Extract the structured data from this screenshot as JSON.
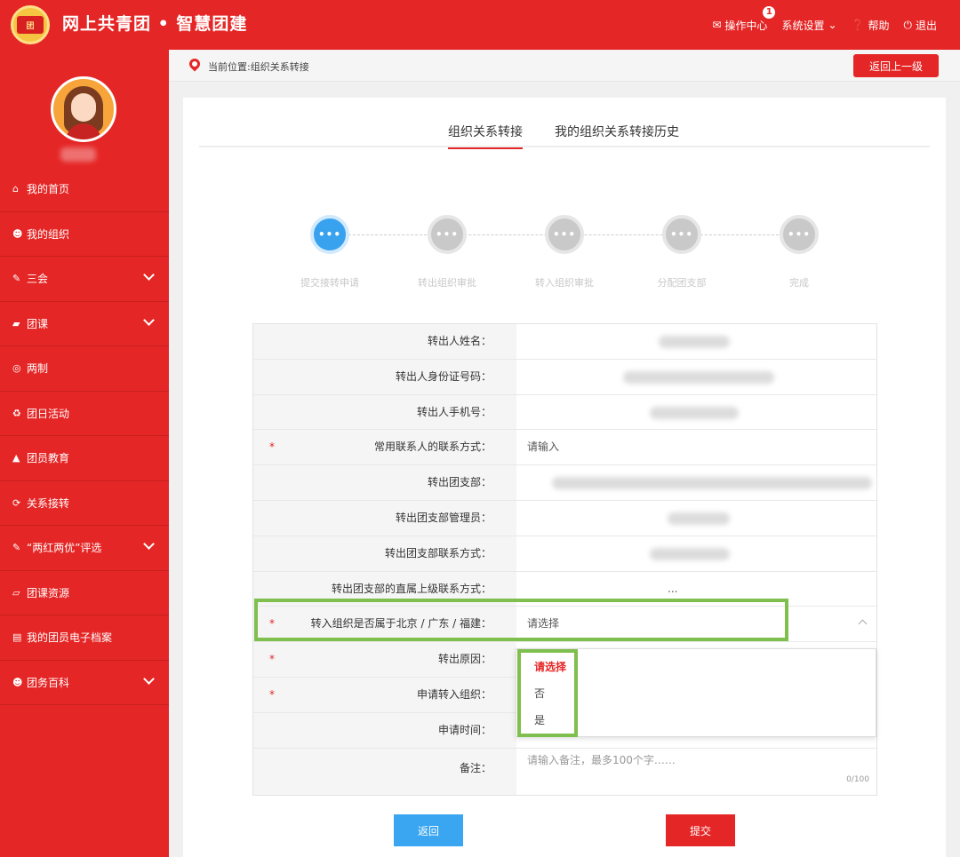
{
  "header": {
    "logo_text": "团",
    "title": "网上共青团 • 智慧团建",
    "nav": [
      {
        "icon": "envelope-icon",
        "label": "操作中心",
        "badge": "1"
      },
      {
        "icon": "chevron-down-icon",
        "label": "系统设置"
      },
      {
        "icon": "question-icon",
        "label": "帮助"
      },
      {
        "icon": "power-icon",
        "label": "退出"
      }
    ]
  },
  "sidebar": {
    "items": [
      {
        "icon": "home-icon",
        "label": "我的首页",
        "has_submenu": false
      },
      {
        "icon": "users-icon",
        "label": "我的组织",
        "has_submenu": false
      },
      {
        "icon": "edit-icon",
        "label": "三会",
        "has_submenu": true
      },
      {
        "icon": "folder-icon",
        "label": "团课",
        "has_submenu": true
      },
      {
        "icon": "target-icon",
        "label": "两制",
        "has_submenu": false
      },
      {
        "icon": "recycle-icon",
        "label": "团日活动",
        "has_submenu": false
      },
      {
        "icon": "graduation-cap-icon",
        "label": "团员教育",
        "has_submenu": false
      },
      {
        "icon": "refresh-icon",
        "label": "关系接转",
        "has_submenu": false
      },
      {
        "icon": "edit-icon",
        "label": "“两红两优”评选",
        "has_submenu": true
      },
      {
        "icon": "folder-open-icon",
        "label": "团课资源",
        "has_submenu": false
      },
      {
        "icon": "file-icon",
        "label": "我的团员电子档案",
        "has_submenu": false
      },
      {
        "icon": "users-icon",
        "label": "团务百科",
        "has_submenu": true
      }
    ]
  },
  "breadcrumb": {
    "text": "当前位置:组织关系转接",
    "back_button": "返回上一级"
  },
  "tabs": [
    {
      "label": "组织关系转接",
      "active": true
    },
    {
      "label": "我的组织关系转接历史",
      "active": false
    }
  ],
  "steps": [
    {
      "dots": "•••",
      "label": "提交接转申请",
      "active": true
    },
    {
      "dots": "•••",
      "label": "转出组织审批",
      "active": false
    },
    {
      "dots": "•••",
      "label": "转入组织审批",
      "active": false
    },
    {
      "dots": "•••",
      "label": "分配团支部",
      "active": false
    },
    {
      "dots": "•••",
      "label": "完成",
      "active": false
    }
  ],
  "form": {
    "rows": [
      {
        "label": "转出人姓名：",
        "required": false,
        "value": ""
      },
      {
        "label": "转出人身份证号码：",
        "required": false,
        "value": ""
      },
      {
        "label": "转出人手机号：",
        "required": false,
        "value": ""
      },
      {
        "label": "常用联系人的联系方式：",
        "required": true,
        "value": "请输入"
      },
      {
        "label": "转出团支部：",
        "required": false,
        "value": ""
      },
      {
        "label": "转出团支部管理员：",
        "required": false,
        "value": ""
      },
      {
        "label": "转出团支部联系方式：",
        "required": false,
        "value": ""
      },
      {
        "label": "转出团支部的直属上级联系方式：",
        "required": false,
        "value": "..."
      },
      {
        "label": "转入组织是否属于北京 / 广东 / 福建：",
        "required": true,
        "value": "请选择"
      },
      {
        "label": "转出原因：",
        "required": true,
        "value": ""
      },
      {
        "label": "申请转入组织：",
        "required": true,
        "value": ""
      },
      {
        "label": "申请时间：",
        "required": false,
        "value": ""
      }
    ],
    "remark": {
      "label": "备注：",
      "placeholder": "请输入备注，最多100个字……",
      "counter": "0/100"
    },
    "required_mark": "*"
  },
  "dropdown": {
    "options": [
      {
        "label": "请选择",
        "selected": true
      },
      {
        "label": "否",
        "selected": false
      },
      {
        "label": "是",
        "selected": false
      }
    ]
  },
  "buttons": {
    "back": "返回",
    "submit": "提交"
  },
  "colors": {
    "brand_red": "#e52626",
    "blue": "#3aa6f1",
    "highlight_green": "#7fbf4d"
  }
}
